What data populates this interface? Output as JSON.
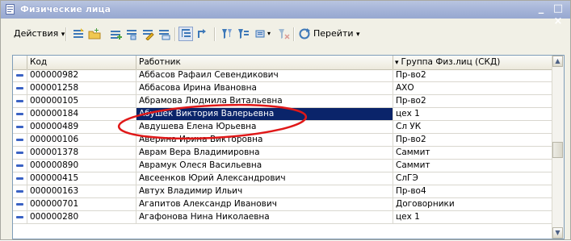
{
  "window": {
    "title": "Физические лица",
    "minimize_glyph": "_",
    "close_glyph": "□ ×"
  },
  "toolbar": {
    "actions_label": "Действия",
    "goto_label": "Перейти",
    "dropdown_glyph": "▾"
  },
  "table": {
    "columns": [
      "Код",
      "Работник",
      "Группа Физ.лиц (СКД)"
    ],
    "sort_indicator": "▾",
    "rows": [
      {
        "code": "000000982",
        "name": "Аббасов Рафаил Севендикович",
        "group": "Пр-во2"
      },
      {
        "code": "000001258",
        "name": "Аббасова Ирина Ивановна",
        "group": "АХО"
      },
      {
        "code": "000000105",
        "name": "Абрамова Людмила Витальевна",
        "group": "Пр-во2"
      },
      {
        "code": "000000184",
        "name": "Абушек Виктория Валерьевна",
        "group": "цех 1"
      },
      {
        "code": "000000489",
        "name": "Авдушева Елена Юрьевна",
        "group": "Сл УК"
      },
      {
        "code": "000000106",
        "name": "Аверина Ирина Викторовна",
        "group": "Пр-во2"
      },
      {
        "code": "000001378",
        "name": "Аврам Вера Владимировна",
        "group": "Саммит"
      },
      {
        "code": "000000890",
        "name": "Аврамук Олеся Васильевна",
        "group": "Саммит"
      },
      {
        "code": "000000415",
        "name": "Авсеенков Юрий Александрович",
        "group": "СлГЭ"
      },
      {
        "code": "000000163",
        "name": "Автух Владимир Ильич",
        "group": "Пр-во4"
      },
      {
        "code": "000000701",
        "name": "Агапитов Александр Иванович",
        "group": "Договорники"
      },
      {
        "code": "000000280",
        "name": "Агафонова Нина Николаевна",
        "group": "цех 1"
      }
    ],
    "selected_row_index": 3
  },
  "colors": {
    "selection": "#0a246a",
    "annotation": "#e01818",
    "title_gradient": "#a7b6d9"
  },
  "icons": [
    "document-icon",
    "list-icon",
    "add-folder-icon",
    "add-icon",
    "copy-icon",
    "edit-icon",
    "delete-icon",
    "tree-icon",
    "hierarchy-icon",
    "filter-icon",
    "filter-list-icon",
    "print-icon",
    "clear-filter-icon",
    "refresh-icon"
  ]
}
